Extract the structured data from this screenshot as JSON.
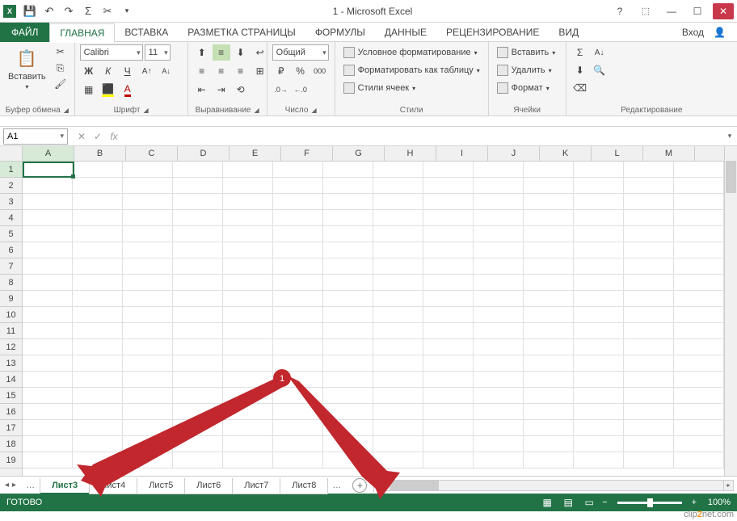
{
  "title": "1 - Microsoft Excel",
  "file_tab": "ФАЙЛ",
  "tabs": [
    "ГЛАВНАЯ",
    "ВСТАВКА",
    "РАЗМЕТКА СТРАНИЦЫ",
    "ФОРМУЛЫ",
    "ДАННЫЕ",
    "РЕЦЕНЗИРОВАНИЕ",
    "ВИД"
  ],
  "active_tab": 0,
  "signin": "Вход",
  "ribbon": {
    "clipboard": {
      "paste": "Вставить",
      "label": "Буфер обмена"
    },
    "font": {
      "name": "Calibri",
      "size": "11",
      "label": "Шрифт"
    },
    "alignment": {
      "label": "Выравнивание"
    },
    "number": {
      "format": "Общий",
      "label": "Число"
    },
    "styles": {
      "conditional": "Условное форматирование",
      "table": "Форматировать как таблицу",
      "cell": "Стили ячеек",
      "label": "Стили"
    },
    "cells": {
      "insert": "Вставить",
      "delete": "Удалить",
      "format": "Формат",
      "label": "Ячейки"
    },
    "editing": {
      "label": "Редактирование"
    }
  },
  "name_box": "A1",
  "columns": [
    "A",
    "B",
    "C",
    "D",
    "E",
    "F",
    "G",
    "H",
    "I",
    "J",
    "K",
    "L",
    "M"
  ],
  "rows": [
    "1",
    "2",
    "3",
    "4",
    "5",
    "6",
    "7",
    "8",
    "9",
    "10",
    "11",
    "12",
    "13",
    "14",
    "15",
    "16",
    "17",
    "18",
    "19"
  ],
  "sheets": [
    "Лист3",
    "Лист4",
    "Лист5",
    "Лист6",
    "Лист7",
    "Лист8"
  ],
  "active_sheet": 0,
  "status": "ГОТОВО",
  "zoom": "100%",
  "annotation_badge": "1",
  "watermark": {
    "pre": "clip",
    "mid": "2",
    "post": "net",
    "ext": ".com"
  }
}
